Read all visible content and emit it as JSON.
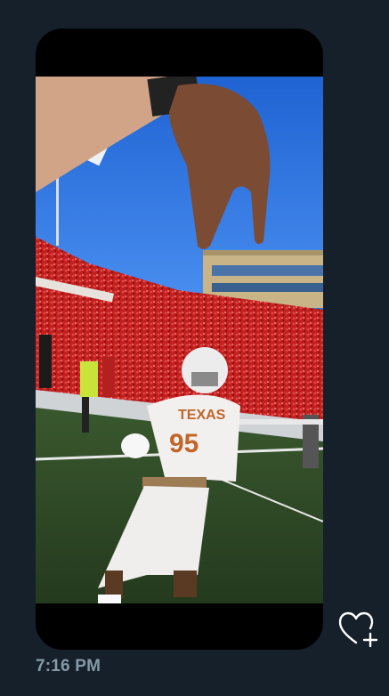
{
  "tweet": {
    "time": "7:16 PM"
  },
  "media": {
    "type": "video",
    "jersey_text": "TEXAS",
    "jersey_number": "95"
  },
  "actions": {
    "like_icon": "heart-add-icon"
  },
  "colors": {
    "background": "#15202b",
    "frame": "#000000",
    "timestamp": "#8899a6",
    "icon_stroke": "#ffffff"
  }
}
